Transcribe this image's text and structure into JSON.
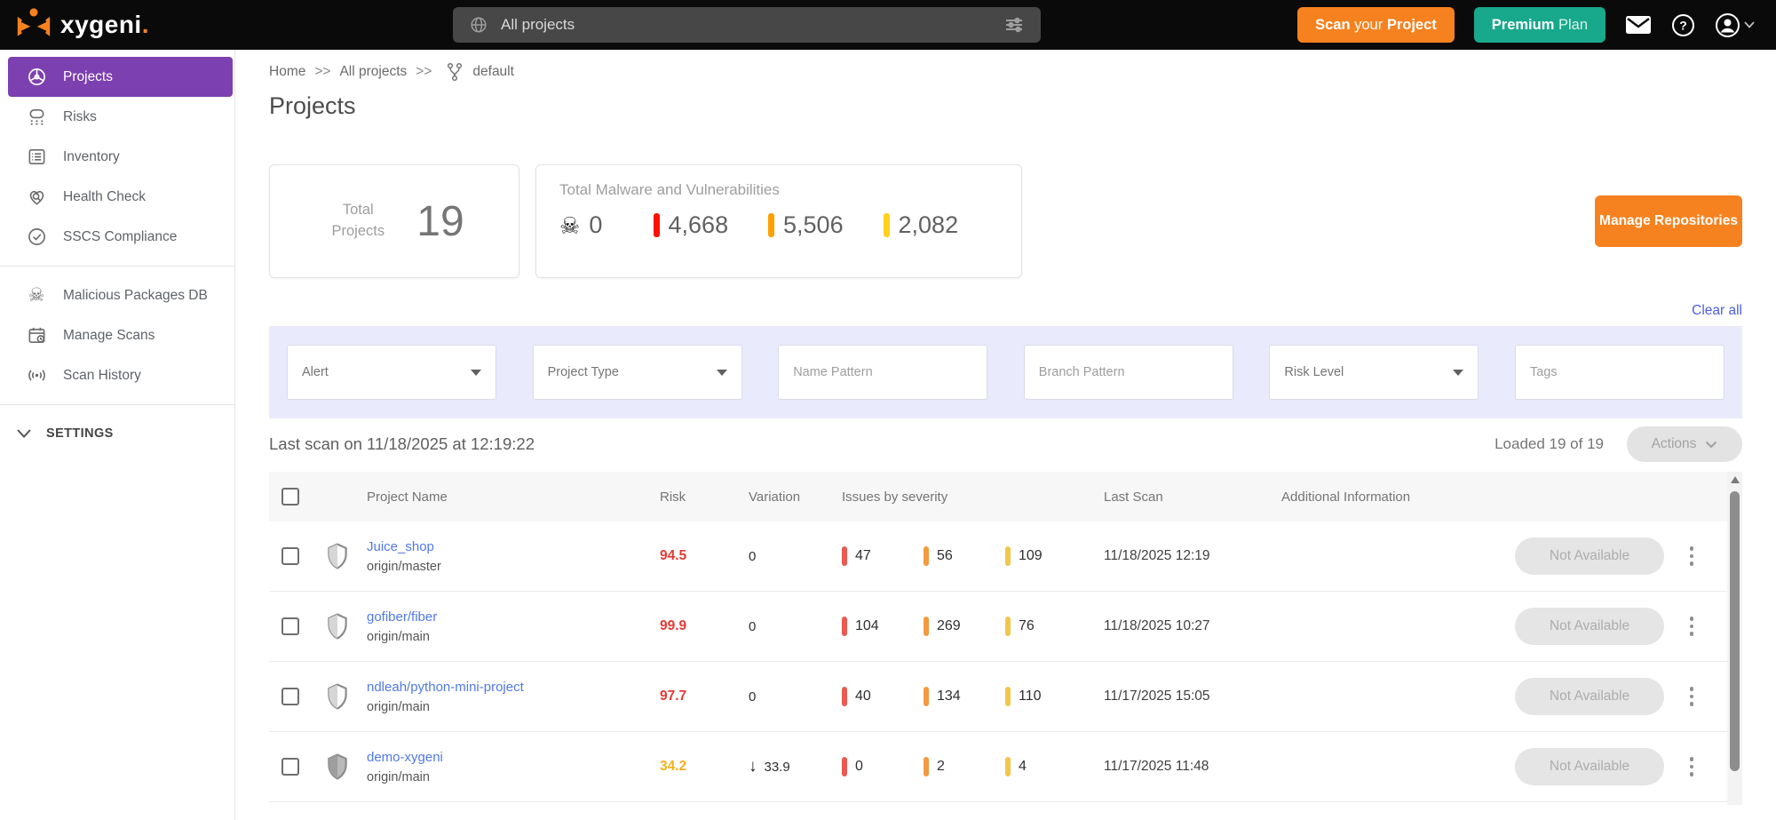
{
  "icons": {
    "skull": "☠",
    "arrow_down": "↓"
  },
  "colors": {
    "accent_orange": "#f6821f",
    "accent_teal": "#18a88b",
    "sidebar_selected": "#7c40b0",
    "link_blue": "#5179e8",
    "clear_all_link": "#4a5de0",
    "card_red": "#fb1200",
    "card_orange": "#ffa000",
    "card_yellow": "#fdd21c",
    "sev_red": "#ea5a50",
    "sev_orange": "#f29a3f",
    "sev_yellow": "#f2c64b"
  },
  "topbar": {
    "brand_name": "xygeni",
    "brand_dot": ".",
    "project_selector": {
      "value": "All projects"
    },
    "scan_button": {
      "part1": "Scan",
      "part2": "your",
      "part3": "Project"
    },
    "premium_button": {
      "part1": "Premium",
      "part2": "Plan"
    }
  },
  "sidebar": {
    "items": [
      {
        "label": "Projects"
      },
      {
        "label": "Risks"
      },
      {
        "label": "Inventory"
      },
      {
        "label": "Health Check"
      },
      {
        "label": "SSCS Compliance"
      },
      {
        "label": "Malicious Packages DB"
      },
      {
        "label": "Manage Scans"
      },
      {
        "label": "Scan History"
      }
    ],
    "settings_label": "SETTINGS"
  },
  "breadcrumb": {
    "home": "Home",
    "separator": ">>",
    "all_projects": "All projects",
    "branch": "default"
  },
  "page": {
    "title": "Projects"
  },
  "stats": {
    "total_projects": {
      "label": "Total Projects",
      "value": "19"
    },
    "malware": {
      "title": "Total Malware and Vulnerabilities",
      "malware_count": "0",
      "critical": "4,668",
      "high": "5,506",
      "medium": "2,082"
    }
  },
  "buttons": {
    "manage_repositories": "Manage Repositories",
    "actions": "Actions"
  },
  "filter_bar": {
    "clear_all": "Clear all",
    "fields": [
      {
        "label": "Alert"
      },
      {
        "label": "Project Type"
      },
      {
        "placeholder": "Name Pattern"
      },
      {
        "placeholder": "Branch Pattern"
      },
      {
        "label": "Risk Level"
      },
      {
        "placeholder": "Tags"
      }
    ]
  },
  "scan_info": {
    "last_scan": "Last scan on 11/18/2025 at 12:19:22",
    "loaded": "Loaded 19 of 19"
  },
  "table": {
    "columns": {
      "project_name": "Project Name",
      "risk": "Risk",
      "variation": "Variation",
      "issues": "Issues by severity",
      "last_scan": "Last Scan",
      "additional_info": "Additional Information"
    },
    "not_available": "Not Available",
    "rows": [
      {
        "name": "Juice_shop",
        "branch": "origin/master",
        "risk": "94.5",
        "risk_color": "#e53935",
        "variation": "0",
        "critical": "47",
        "high": "56",
        "medium": "109",
        "last_scan": "11/18/2025 12:19"
      },
      {
        "name": "gofiber/fiber",
        "branch": "origin/main",
        "risk": "99.9",
        "risk_color": "#e53935",
        "variation": "0",
        "critical": "104",
        "high": "269",
        "medium": "76",
        "last_scan": "11/18/2025 10:27"
      },
      {
        "name": "ndleah/python-mini-project",
        "branch": "origin/main",
        "risk": "97.7",
        "risk_color": "#e53935",
        "variation": "0",
        "critical": "40",
        "high": "134",
        "medium": "110",
        "last_scan": "11/17/2025 15:05"
      },
      {
        "name": "demo-xygeni",
        "branch": "origin/main",
        "risk": "34.2",
        "risk_color": "#f2b21d",
        "variation": "33.9",
        "critical": "0",
        "high": "2",
        "medium": "4",
        "last_scan": "11/17/2025 11:48"
      }
    ]
  }
}
